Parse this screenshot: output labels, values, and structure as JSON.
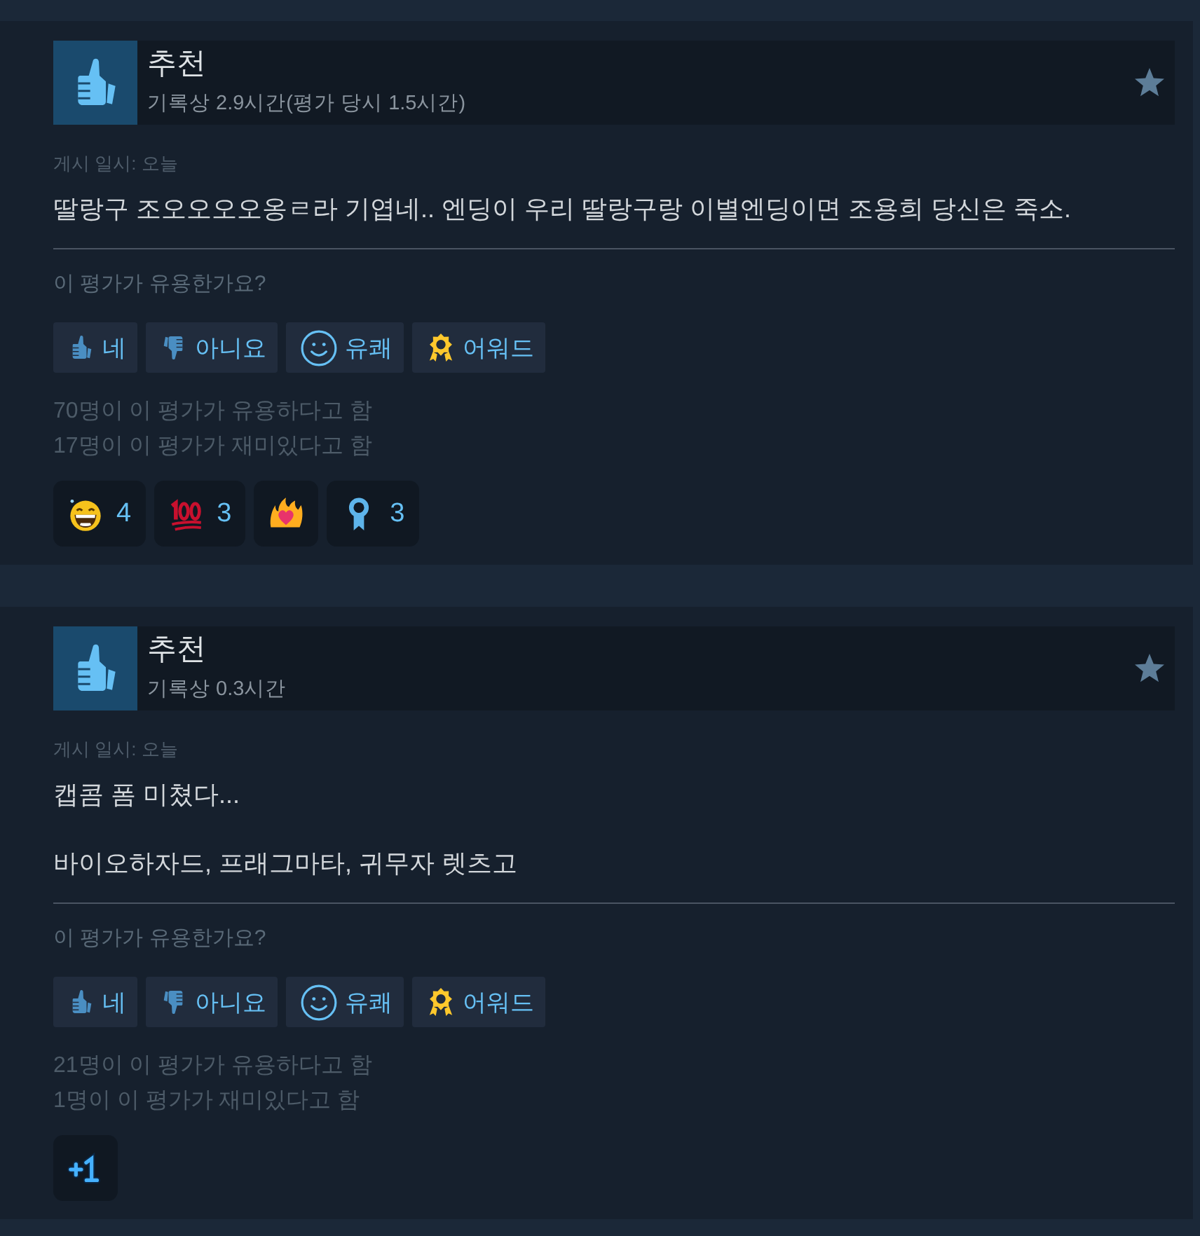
{
  "reviews": [
    {
      "recommended": true,
      "verdict": "추천",
      "hours": "기록상 2.9시간(평가 당시 1.5시간)",
      "posted": "게시 일시: 오늘",
      "body": [
        "딸랑구 조오오오오옹ㄹ라 기엽네.. 엔딩이 우리 딸랑구랑 이별엔딩이면 조용희 당신은 죽소."
      ],
      "helpful_question": "이 평가가 유용한가요?",
      "vote_buttons": [
        {
          "kind": "yes",
          "label": "네"
        },
        {
          "kind": "no",
          "label": "아니요"
        },
        {
          "kind": "funny",
          "label": "유쾌"
        },
        {
          "kind": "award",
          "label": "어워드"
        }
      ],
      "tallies": [
        "70명이 이 평가가 유용하다고 함",
        "17명이 이 평가가 재미있다고 함"
      ],
      "reactions": [
        {
          "kind": "laughing",
          "count": "4"
        },
        {
          "kind": "hundred",
          "count": "3"
        },
        {
          "kind": "fire-heart"
        },
        {
          "kind": "ribbon",
          "count": "3"
        }
      ]
    },
    {
      "recommended": true,
      "verdict": "추천",
      "hours": "기록상 0.3시간",
      "posted": "게시 일시: 오늘",
      "body": [
        "캡콤 폼 미쳤다...",
        "바이오하자드, 프래그마타, 귀무자 렛츠고"
      ],
      "helpful_question": "이 평가가 유용한가요?",
      "vote_buttons": [
        {
          "kind": "yes",
          "label": "네"
        },
        {
          "kind": "no",
          "label": "아니요"
        },
        {
          "kind": "funny",
          "label": "유쾌"
        },
        {
          "kind": "award",
          "label": "어워드"
        }
      ],
      "tallies": [
        "21명이 이 평가가 유용하다고 함",
        "1명이 이 평가가 재미있다고 함"
      ],
      "reactions": [
        {
          "kind": "plus-one"
        }
      ]
    }
  ]
}
